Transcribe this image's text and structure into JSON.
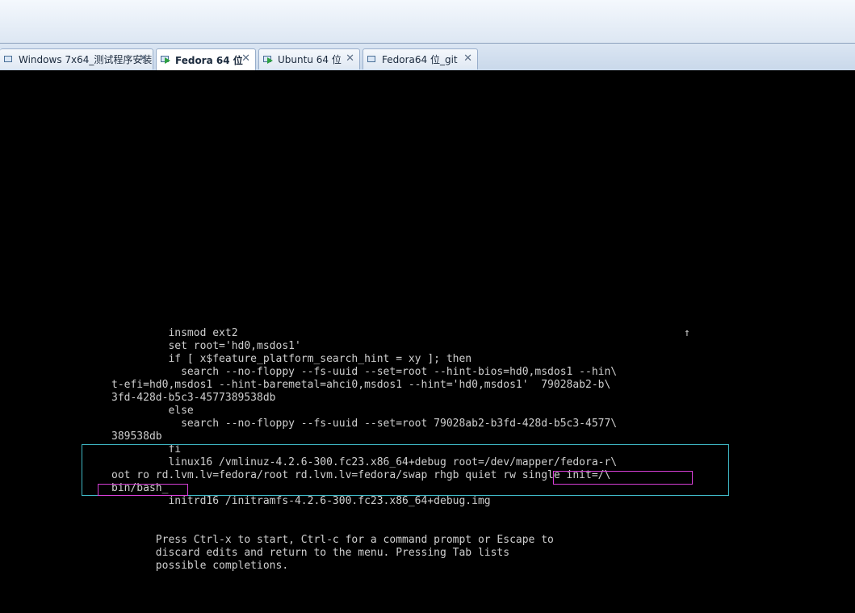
{
  "tabs": [
    {
      "label": "Windows 7x64_测试程序安装",
      "active": false,
      "running": false
    },
    {
      "label": "Fedora 64 位",
      "active": true,
      "running": true
    },
    {
      "label": "Ubuntu 64 位",
      "active": false,
      "running": true
    },
    {
      "label": "Fedora64 位_git",
      "active": false,
      "running": false
    }
  ],
  "tab_close_glyph": "✕",
  "console": {
    "lines": [
      "         insmod ext2",
      "         set root='hd0,msdos1'",
      "         if [ x$feature_platform_search_hint = xy ]; then",
      "           search --no-floppy --fs-uuid --set=root --hint-bios=hd0,msdos1 --hin\\",
      "t-efi=hd0,msdos1 --hint-baremetal=ahci0,msdos1 --hint='hd0,msdos1'  79028ab2-b\\",
      "3fd-428d-b5c3-4577389538db",
      "         else",
      "           search --no-floppy --fs-uuid --set=root 79028ab2-b3fd-428d-b5c3-4577\\",
      "389538db",
      "         fi",
      "         linux16 /vmlinuz-4.2.6-300.fc23.x86_64+debug root=/dev/mapper/fedora-r\\",
      "oot ro rd.lvm.lv=fedora/root rd.lvm.lv=fedora/swap rhgb quiet rw single init=/\\",
      "bin/bash_",
      "         initrd16 /initramfs-4.2.6-300.fc23.x86_64+debug.img",
      "",
      "",
      "       Press Ctrl-x to start, Ctrl-c for a command prompt or Escape to",
      "       discard edits and return to the menu. Pressing Tab lists",
      "       possible completions."
    ],
    "scroll_indicator": "↑",
    "colors": {
      "text": "#cfcfcf",
      "background": "#000000",
      "highlight_cyan": "#3fb8c6",
      "highlight_magenta": "#d63fd6"
    }
  }
}
